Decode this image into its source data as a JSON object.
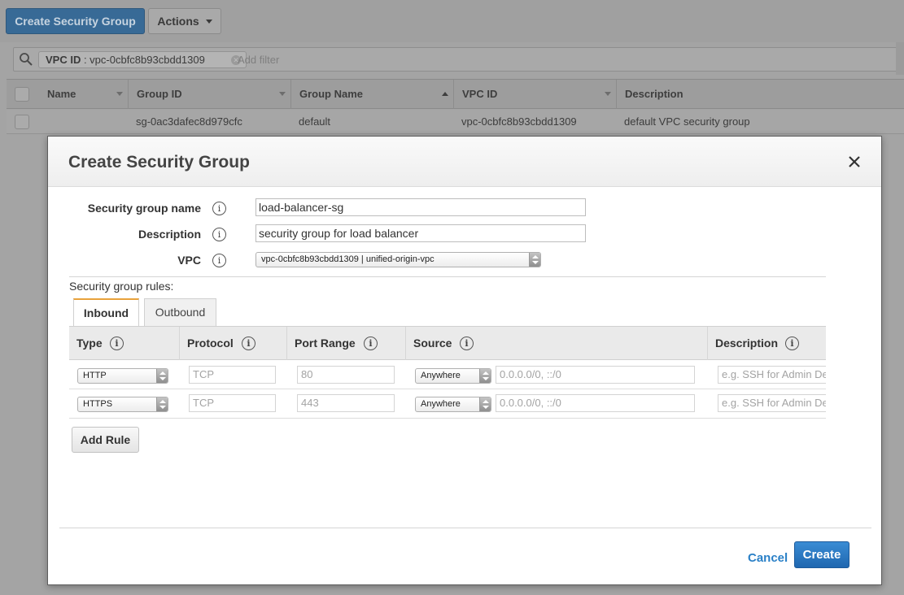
{
  "toolbar": {
    "create_security_group_label": "Create Security Group",
    "actions_label": "Actions"
  },
  "filter": {
    "chip_key": "VPC ID",
    "chip_value": " : vpc-0cbfc8b93cbdd1309",
    "placeholder": "Add filter"
  },
  "table": {
    "columns": [
      "Name",
      "Group ID",
      "Group Name",
      "VPC ID",
      "Description"
    ],
    "rows": [
      {
        "name": "",
        "group_id": "sg-0ac3dafec8d979cfc",
        "group_name": "default",
        "vpc_id": "vpc-0cbfc8b93cbdd1309",
        "description": "default VPC security group"
      }
    ]
  },
  "modal": {
    "title": "Create Security Group",
    "fields": {
      "name_label": "Security group name",
      "name_value": "load-balancer-sg",
      "description_label": "Description",
      "description_value": "security group for load balancer",
      "vpc_label": "VPC",
      "vpc_value": "vpc-0cbfc8b93cbdd1309 | unified-origin-vpc"
    },
    "rules_label": "Security group rules:",
    "tabs": [
      "Inbound",
      "Outbound"
    ],
    "rules_columns": [
      "Type",
      "Protocol",
      "Port Range",
      "Source",
      "Description"
    ],
    "rules": [
      {
        "type": "HTTP",
        "protocol": "TCP",
        "port_range": "80",
        "source": "Anywhere",
        "cidr": "0.0.0.0/0, ::/0",
        "description_placeholder": "e.g. SSH for Admin Desktop"
      },
      {
        "type": "HTTPS",
        "protocol": "TCP",
        "port_range": "443",
        "source": "Anywhere",
        "cidr": "0.0.0.0/0, ::/0",
        "description_placeholder": "e.g. SSH for Admin Desktop"
      }
    ],
    "add_rule_label": "Add Rule",
    "cancel_label": "Cancel",
    "create_label": "Create",
    "info_glyph": "i"
  },
  "colors": {
    "primary_button": "#1f67b0",
    "link": "#2a80c7",
    "active_tab_accent": "#e8a23b"
  }
}
